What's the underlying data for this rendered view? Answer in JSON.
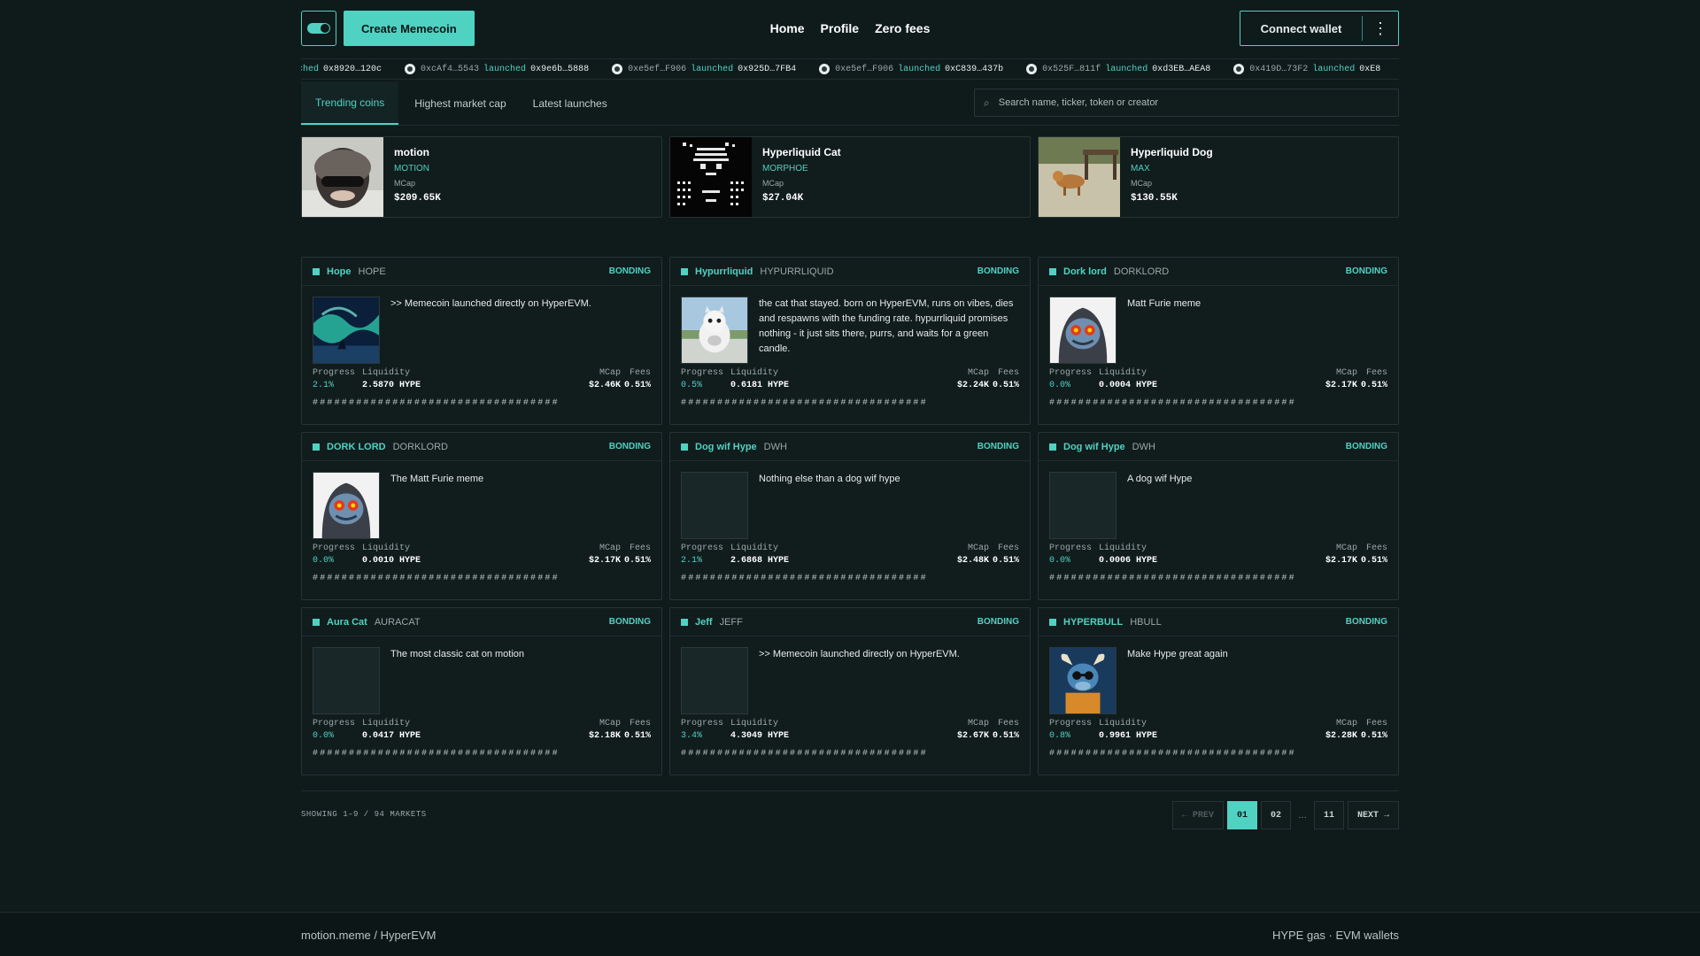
{
  "header": {
    "create_label": "Create Memecoin",
    "nav": [
      "Home",
      "Profile",
      "Zero fees"
    ],
    "wallet_label": "Connect wallet",
    "more_glyph": "⋮"
  },
  "ticker": [
    {
      "addr": "",
      "word": "ched",
      "target": "0x8920…120c",
      "partial": true
    },
    {
      "addr": "0xcAf4…5543",
      "word": "launched",
      "target": "0x9e6b…5888"
    },
    {
      "addr": "0xe5ef…F906",
      "word": "launched",
      "target": "0x925D…7FB4"
    },
    {
      "addr": "0xe5ef…F906",
      "word": "launched",
      "target": "0xC839…437b"
    },
    {
      "addr": "0x525F…811f",
      "word": "launched",
      "target": "0xd3EB…AEA8"
    },
    {
      "addr": "0x419D…73F2",
      "word": "launched",
      "target": "0xE8"
    }
  ],
  "tabs": [
    "Trending coins",
    "Highest market cap",
    "Latest launches"
  ],
  "search": {
    "placeholder": "Search name, ticker, token or creator",
    "icon": "⌕"
  },
  "featured": [
    {
      "name": "motion",
      "ticker": "MOTION",
      "mcap_label": "MCap",
      "mcap": "$209.65K"
    },
    {
      "name": "Hyperliquid Cat",
      "ticker": "MORPHOE",
      "mcap_label": "MCap",
      "mcap": "$27.04K"
    },
    {
      "name": "Hyperliquid Dog",
      "ticker": "MAX",
      "mcap_label": "MCap",
      "mcap": "$130.55K"
    }
  ],
  "stat_labels": {
    "progress": "Progress",
    "liquidity": "Liquidity",
    "mcap": "MCap",
    "fees": "Fees"
  },
  "progress_bar": "##################################",
  "coins": [
    {
      "name": "Hope",
      "ticker": "HOPE",
      "badge": "BONDING",
      "desc": ">> Memecoin launched directly on HyperEVM.",
      "progress": "2.1%",
      "liquidity": "2.5870 HYPE",
      "mcap": "$2.46K",
      "fees": "0.51%",
      "img": "aurora"
    },
    {
      "name": "Hypurrliquid",
      "ticker": "HYPURRLIQUID",
      "badge": "BONDING",
      "desc": "the cat that stayed. born on HyperEVM, runs on vibes, dies and respawns with the funding rate. hypurrliquid promises nothing - it just sits there, purrs, and waits for a green candle.",
      "progress": "0.5%",
      "liquidity": "0.6181 HYPE",
      "mcap": "$2.24K",
      "fees": "0.51%",
      "img": "cat"
    },
    {
      "name": "Dork lord",
      "ticker": "DORKLORD",
      "badge": "BONDING",
      "desc": "Matt Furie meme",
      "progress": "0.0%",
      "liquidity": "0.0004 HYPE",
      "mcap": "$2.17K",
      "fees": "0.51%",
      "img": "dork"
    },
    {
      "name": "DORK LORD",
      "ticker": "DORKLORD",
      "badge": "BONDING",
      "desc": "The Matt Furie meme",
      "progress": "0.0%",
      "liquidity": "0.0010 HYPE",
      "mcap": "$2.17K",
      "fees": "0.51%",
      "img": "dork"
    },
    {
      "name": "Dog wif Hype",
      "ticker": "DWH",
      "badge": "BONDING",
      "desc": "Nothing else than a dog wif hype",
      "progress": "2.1%",
      "liquidity": "2.6868 HYPE",
      "mcap": "$2.48K",
      "fees": "0.51%",
      "img": "empty"
    },
    {
      "name": "Dog wif Hype",
      "ticker": "DWH",
      "badge": "BONDING",
      "desc": "A dog wif Hype",
      "progress": "0.0%",
      "liquidity": "0.0006 HYPE",
      "mcap": "$2.17K",
      "fees": "0.51%",
      "img": "empty"
    },
    {
      "name": "Aura Cat",
      "ticker": "AURACAT",
      "badge": "BONDING",
      "desc": "The most classic cat on motion",
      "progress": "0.0%",
      "liquidity": "0.0417 HYPE",
      "mcap": "$2.18K",
      "fees": "0.51%",
      "img": "empty"
    },
    {
      "name": "Jeff",
      "ticker": "JEFF",
      "badge": "BONDING",
      "desc": ">> Memecoin launched directly on HyperEVM.",
      "progress": "3.4%",
      "liquidity": "4.3049 HYPE",
      "mcap": "$2.67K",
      "fees": "0.51%",
      "img": "empty"
    },
    {
      "name": "HYPERBULL",
      "ticker": "HBULL",
      "badge": "BONDING",
      "desc": "Make Hype great again",
      "progress": "0.8%",
      "liquidity": "0.9961 HYPE",
      "mcap": "$2.28K",
      "fees": "0.51%",
      "img": "bull"
    }
  ],
  "pagination": {
    "showing": "SHOWING 1–9 / 94 MARKETS",
    "prev": "← PREV",
    "pages": [
      "01",
      "02"
    ],
    "dots": "…",
    "last": "11",
    "next": "NEXT →",
    "current": "01"
  },
  "footer": {
    "left": "motion.meme / HyperEVM",
    "right": "HYPE gas · EVM wallets"
  },
  "colors": {
    "accent": "#50d2c2",
    "background": "#0f1a1b",
    "card": "#111c1d"
  }
}
